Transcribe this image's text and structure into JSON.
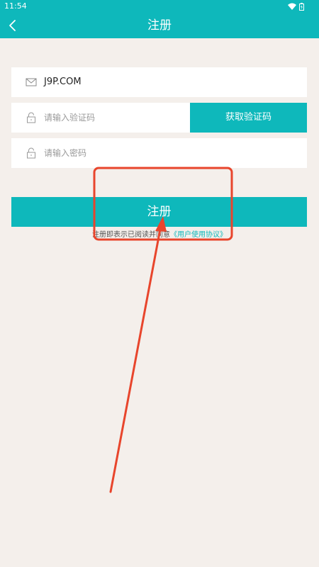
{
  "status_bar": {
    "time": "11:54"
  },
  "header": {
    "title": "注册"
  },
  "form": {
    "account_value": "J9P.COM",
    "code_placeholder": "请输入验证码",
    "get_code_label": "获取验证码",
    "password_placeholder": "请输入密码",
    "register_label": "注册",
    "agreement_prefix": "注册即表示已阅读并同意",
    "agreement_link": "《用户使用协议》"
  },
  "colors": {
    "accent": "#0eb8bb",
    "background": "#f4efeb",
    "annotation": "#e8452c"
  },
  "icons": [
    "back-arrow-icon",
    "wifi-icon",
    "battery-icon",
    "mail-icon",
    "lock-icon"
  ]
}
